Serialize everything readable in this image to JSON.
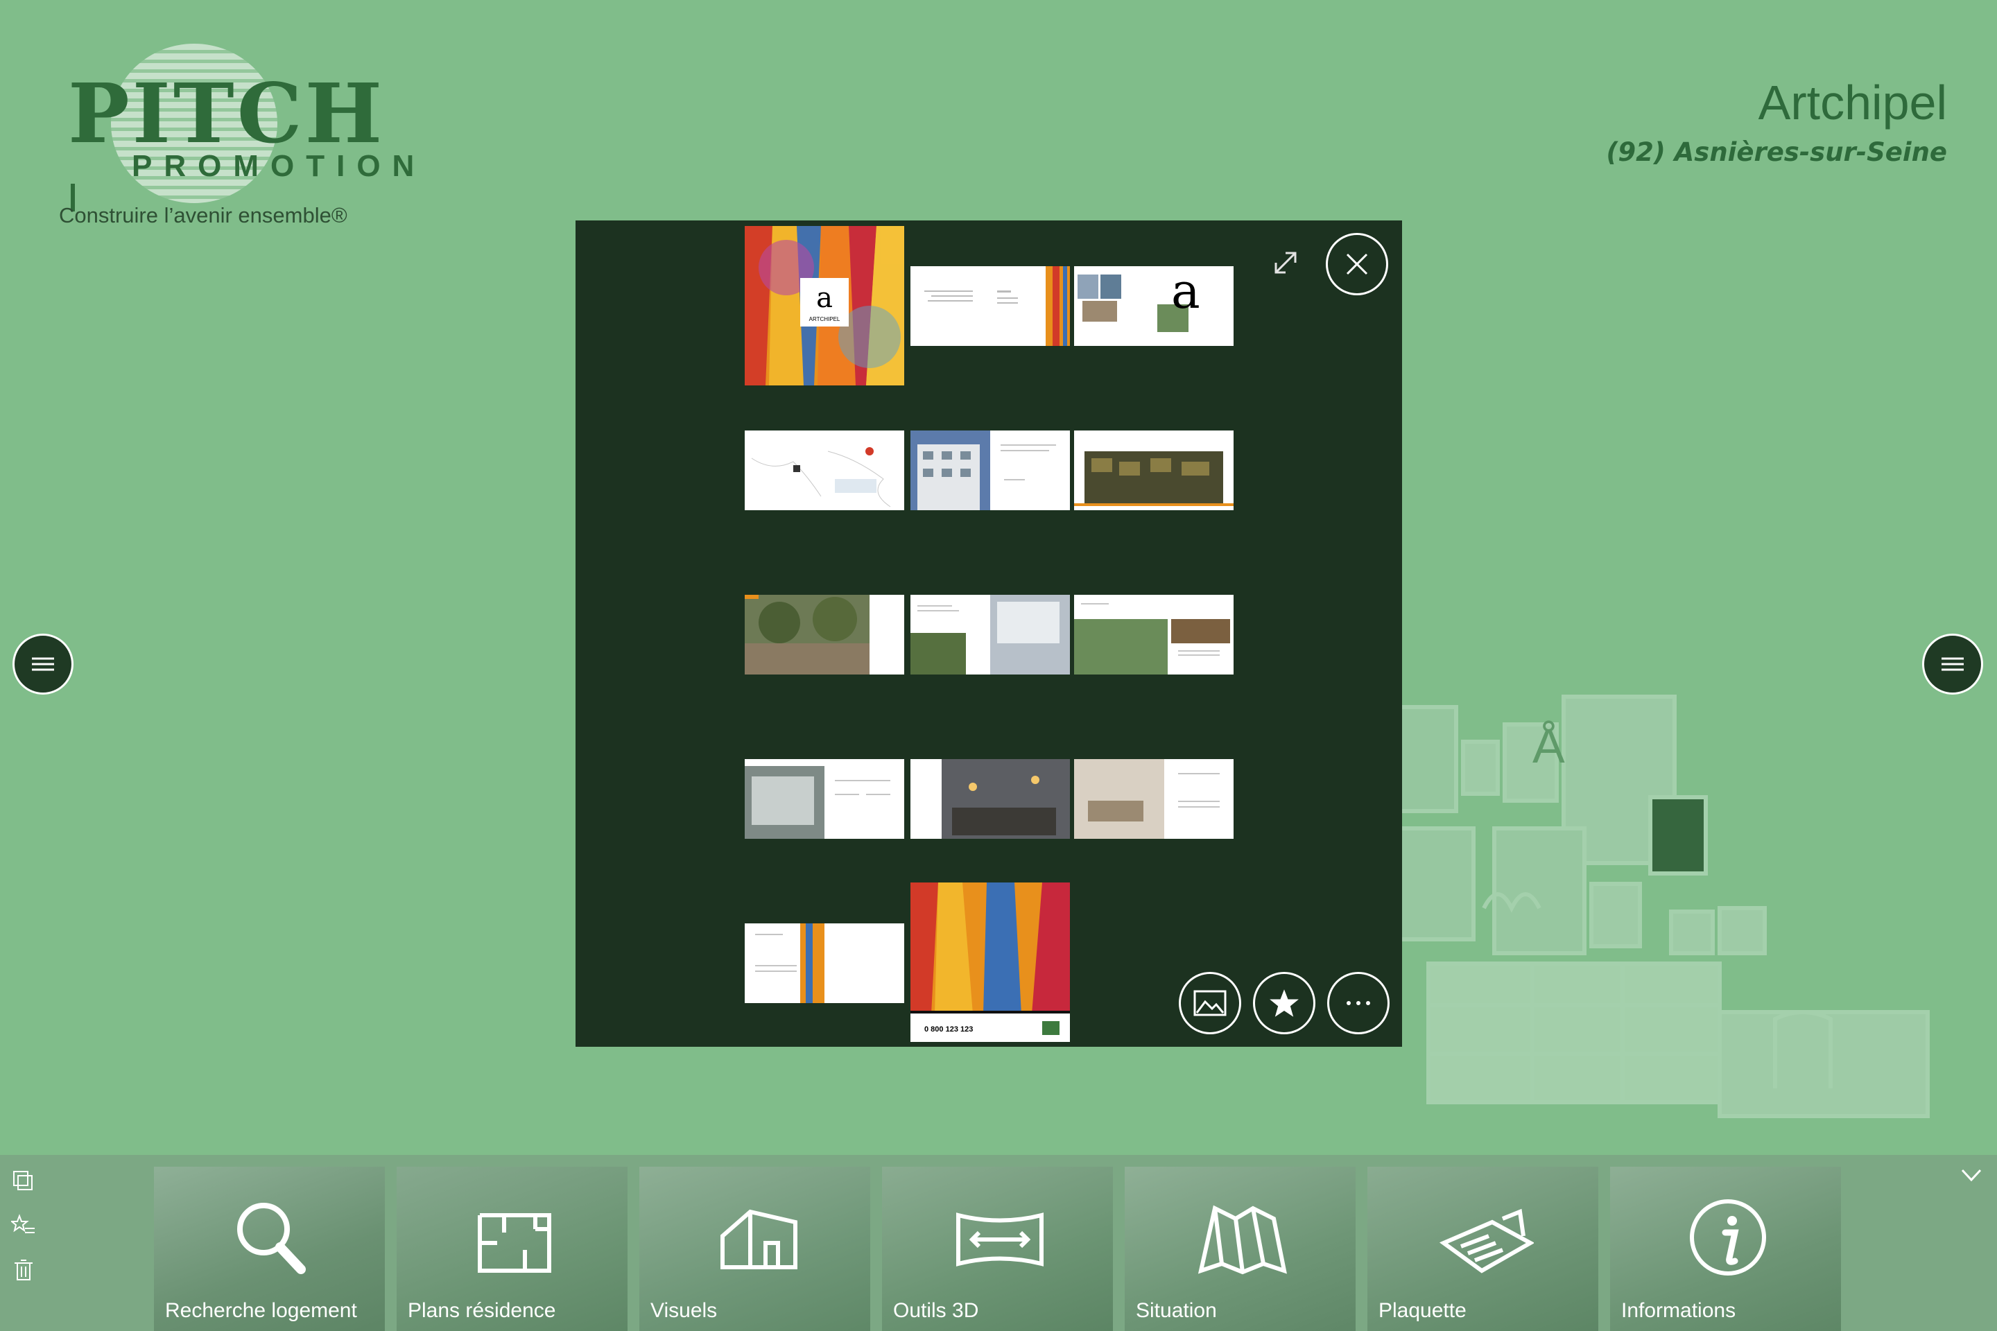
{
  "brand": {
    "name": "PITCH",
    "sub": "PROMOTION",
    "tagline": "Construire l’avenir ensemble®",
    "color": "#2f6b3a"
  },
  "project": {
    "title": "Artchipel",
    "location": "(92) Asnières-sur-Seine"
  },
  "viewer": {
    "background": "#1c3220",
    "page_count": 14,
    "labels": {
      "cover_letter": "a",
      "cover_name": "ARTCHIPEL",
      "back_phone": "0 800 123 123"
    }
  },
  "toolbar": {
    "items": [
      {
        "label": "Recherche logement",
        "icon": "magnifier-icon"
      },
      {
        "label": "Plans résidence",
        "icon": "floorplan-icon"
      },
      {
        "label": "Visuels",
        "icon": "house-icon"
      },
      {
        "label": "Outils 3D",
        "icon": "panorama-icon"
      },
      {
        "label": "Situation",
        "icon": "map-icon"
      },
      {
        "label": "Plaquette",
        "icon": "brochure-icon"
      },
      {
        "label": "Informations",
        "icon": "info-icon"
      }
    ]
  },
  "colors": {
    "page_bg": "#80bd8a",
    "dark_green": "#1f3a24",
    "text_green": "#2e6a3b"
  }
}
